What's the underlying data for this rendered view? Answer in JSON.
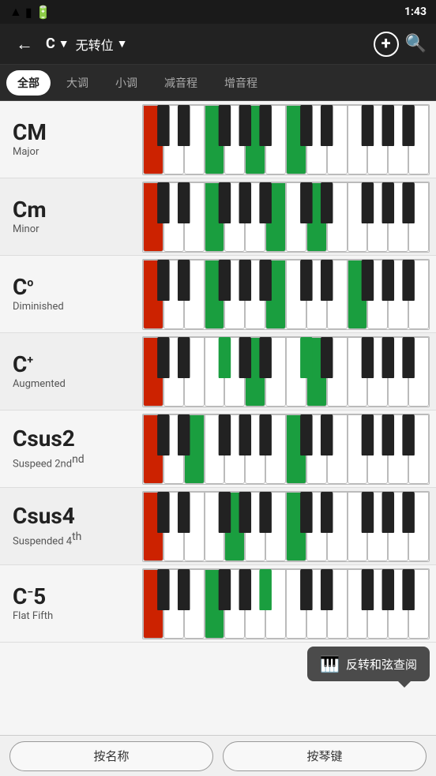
{
  "statusBar": {
    "time": "1:43",
    "icons": [
      "wifi",
      "signal",
      "battery"
    ]
  },
  "toolbar": {
    "backLabel": "←",
    "chordKey": "C",
    "dropdownArrow": "▼",
    "inversion": "无转位",
    "inversionArrow": "▼",
    "addLabel": "+",
    "searchLabel": "🔍"
  },
  "filterTabs": [
    {
      "id": "all",
      "label": "全部",
      "active": true
    },
    {
      "id": "major",
      "label": "大调",
      "active": false
    },
    {
      "id": "minor",
      "label": "小调",
      "active": false
    },
    {
      "id": "diminished",
      "label": "减音程",
      "active": false
    },
    {
      "id": "augmented",
      "label": "增音程",
      "active": false
    }
  ],
  "chords": [
    {
      "symbol": "CM",
      "superscript": "",
      "type": "Major",
      "keys": {
        "whites": [
          "red",
          "white",
          "white",
          "green",
          "white",
          "green",
          "white",
          "green",
          "white",
          "white",
          "white",
          "white",
          "white",
          "white"
        ],
        "blacks": [
          false,
          false,
          false,
          false,
          false,
          false,
          false,
          false,
          false,
          false
        ]
      }
    },
    {
      "symbol": "Cm",
      "superscript": "",
      "type": "Minor",
      "keys": {
        "whites": [
          "red",
          "white",
          "white",
          "green",
          "white",
          "white",
          "green",
          "white",
          "green",
          "white",
          "white",
          "white",
          "white",
          "white"
        ],
        "blacks": [
          false,
          false,
          false,
          false,
          false,
          false,
          false,
          false,
          false,
          false
        ]
      }
    },
    {
      "symbol": "C",
      "superscript": "o",
      "type": "Diminished",
      "keys": {
        "whites": [
          "red",
          "white",
          "white",
          "green",
          "white",
          "white",
          "green",
          "white",
          "white",
          "white",
          "green",
          "white",
          "white",
          "white"
        ],
        "blacks": [
          false,
          false,
          false,
          false,
          false,
          false,
          false,
          false,
          false,
          false
        ]
      }
    },
    {
      "symbol": "C",
      "superscript": "+",
      "type": "Augmented",
      "keys": {
        "whites": [
          "red",
          "white",
          "white",
          "white",
          "white",
          "green",
          "white",
          "white",
          "green",
          "white",
          "white",
          "white",
          "white",
          "white"
        ],
        "blacks": [
          false,
          false,
          true,
          false,
          false,
          true,
          false,
          false,
          false,
          false
        ]
      }
    },
    {
      "symbol": "Csus2",
      "superscript": "",
      "type": "Suspended 2nd",
      "typeSuper": "nd",
      "keys": {
        "whites": [
          "red",
          "white",
          "green",
          "white",
          "white",
          "white",
          "white",
          "green",
          "white",
          "white",
          "white",
          "white",
          "white",
          "white"
        ],
        "blacks": [
          false,
          false,
          false,
          false,
          false,
          false,
          false,
          false,
          false,
          false
        ]
      }
    },
    {
      "symbol": "Csus4",
      "superscript": "",
      "type": "Suspended 4th",
      "typeSuper": "th",
      "keys": {
        "whites": [
          "red",
          "white",
          "white",
          "white",
          "green",
          "white",
          "white",
          "green",
          "white",
          "white",
          "white",
          "white",
          "white",
          "white"
        ],
        "blacks": [
          false,
          false,
          false,
          false,
          false,
          false,
          false,
          false,
          false,
          false
        ]
      }
    },
    {
      "symbol": "C",
      "superscript": "−",
      "symbol2": "5",
      "type": "Flat Fifth",
      "keys": {
        "whites": [
          "red",
          "white",
          "white",
          "green",
          "white",
          "white",
          "white",
          "white",
          "white",
          "white",
          "white",
          "white",
          "white",
          "white"
        ],
        "blacks": [
          false,
          false,
          false,
          false,
          true,
          false,
          false,
          false,
          false,
          false
        ]
      }
    }
  ],
  "bottomButtons": [
    {
      "id": "by-name",
      "label": "按名称"
    },
    {
      "id": "by-key",
      "label": "按琴键"
    }
  ],
  "tooltip": {
    "icon": "🎹",
    "text": "反转和弦查阅"
  }
}
